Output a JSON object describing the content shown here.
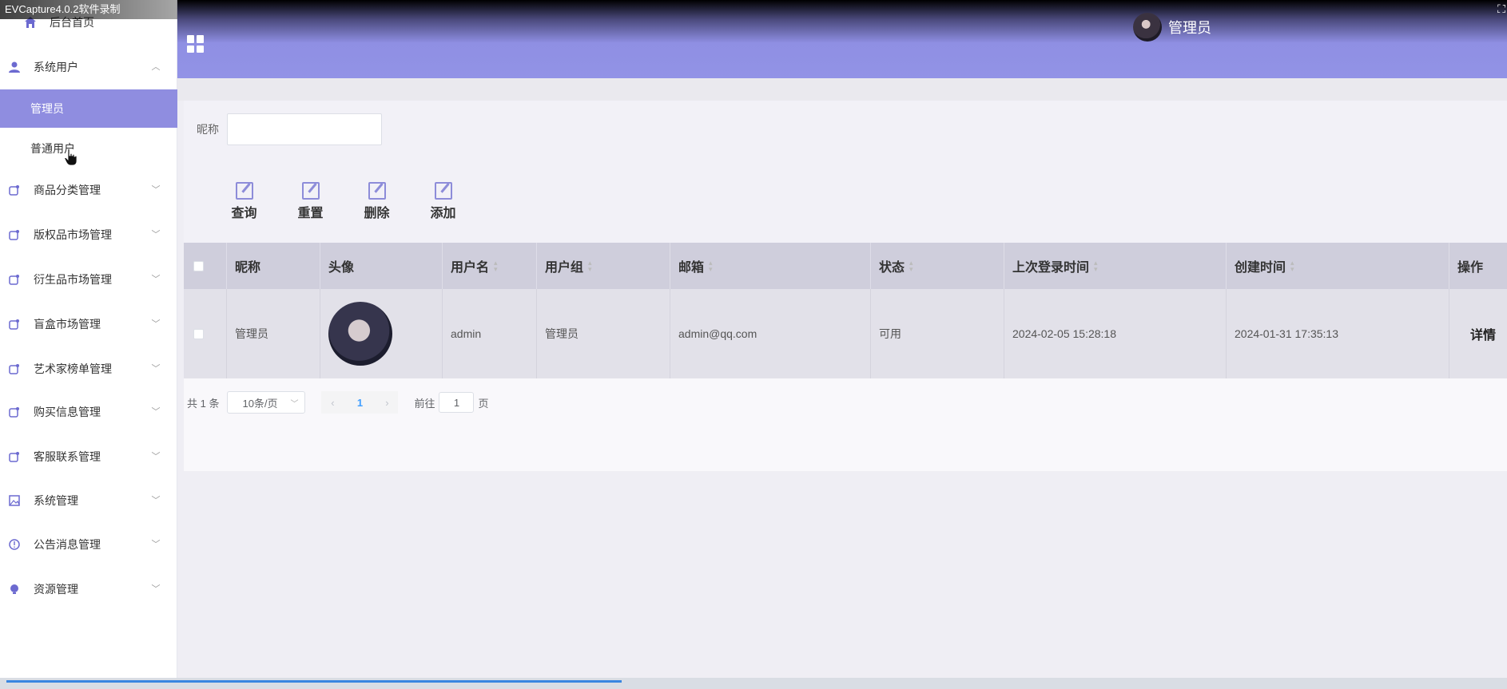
{
  "recorder": {
    "title": "EVCapture4.0.2软件录制"
  },
  "sidebar": {
    "home": "后台首页",
    "group_open": "系统用户",
    "sub_items": [
      "管理员",
      "普通用户"
    ],
    "items": [
      "商品分类管理",
      "版权品市场管理",
      "衍生品市场管理",
      "盲盒市场管理",
      "艺术家榜单管理",
      "购买信息管理",
      "客服联系管理",
      "系统管理",
      "公告消息管理",
      "资源管理"
    ]
  },
  "header": {
    "user_name": "管理员"
  },
  "search": {
    "label": "昵称",
    "value": ""
  },
  "actions": [
    "查询",
    "重置",
    "删除",
    "添加"
  ],
  "table": {
    "headers": [
      "昵称",
      "头像",
      "用户名",
      "用户组",
      "邮箱",
      "状态",
      "上次登录时间",
      "创建时间",
      "操作"
    ],
    "rows": [
      {
        "nickname": "管理员",
        "username": "admin",
        "group": "管理员",
        "email": "admin@qq.com",
        "status": "可用",
        "last_login": "2024-02-05 15:28:18",
        "created": "2024-01-31 17:35:13",
        "op": "详情"
      }
    ]
  },
  "pagination": {
    "total": "共 1 条",
    "page_size": "10条/页",
    "current": "1",
    "goto_prefix": "前往",
    "goto_value": "1",
    "goto_suffix": "页"
  },
  "colors": {
    "accent": "#8f8de0",
    "header": "#9293e6"
  }
}
